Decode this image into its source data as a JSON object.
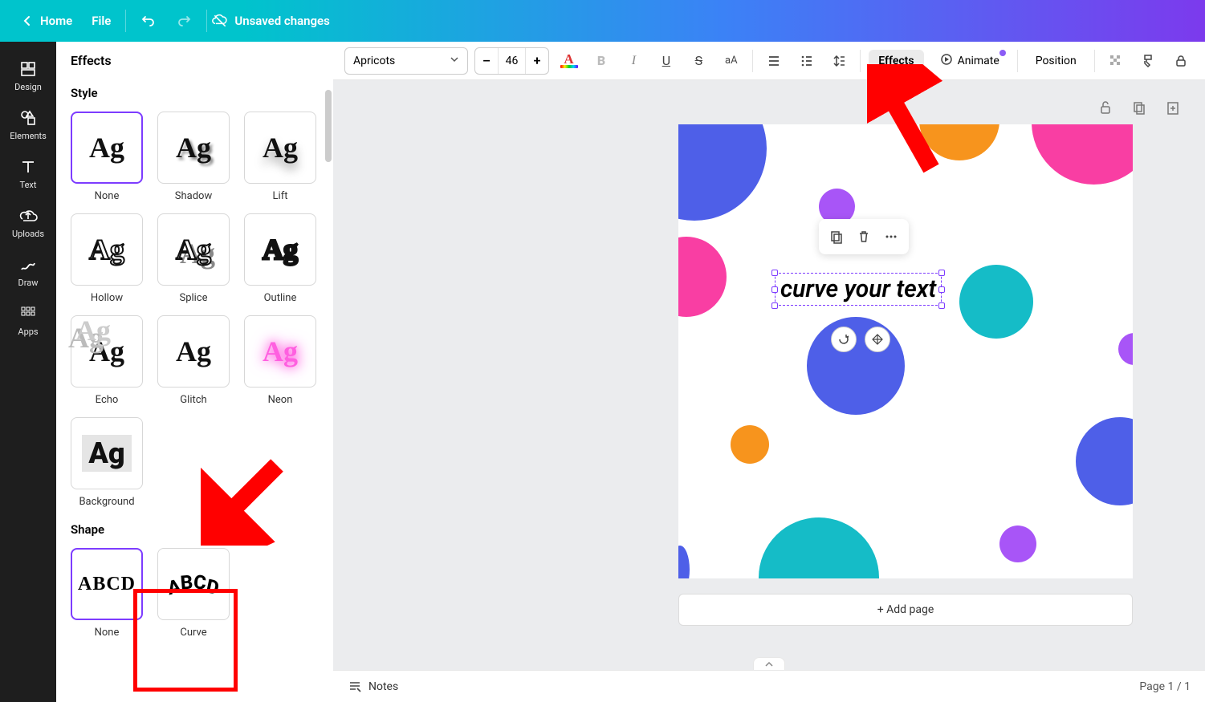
{
  "header": {
    "home": "Home",
    "file": "File",
    "unsaved": "Unsaved changes"
  },
  "rail": {
    "design": "Design",
    "elements": "Elements",
    "text": "Text",
    "uploads": "Uploads",
    "draw": "Draw",
    "apps": "Apps"
  },
  "panel": {
    "title": "Effects",
    "style_heading": "Style",
    "shape_heading": "Shape",
    "styles": {
      "none": "None",
      "shadow": "Shadow",
      "lift": "Lift",
      "hollow": "Hollow",
      "splice": "Splice",
      "outline": "Outline",
      "echo": "Echo",
      "glitch": "Glitch",
      "neon": "Neon",
      "background": "Background"
    },
    "shapes": {
      "none": "None",
      "curve": "Curve"
    },
    "sample_ag": "Ag",
    "sample_abcd": "ABCD"
  },
  "toolbar": {
    "font_name": "Apricots",
    "font_size": "46",
    "minus": "–",
    "plus": "+",
    "effects": "Effects",
    "animate": "Animate",
    "position": "Position"
  },
  "canvas": {
    "text": "curve your text",
    "addpage": "+ Add page"
  },
  "status": {
    "notes": "Notes",
    "page": "Page 1 / 1"
  },
  "annotation": {
    "arrow_to_effects": true,
    "arrow_to_curve": true,
    "box_curve": true
  }
}
